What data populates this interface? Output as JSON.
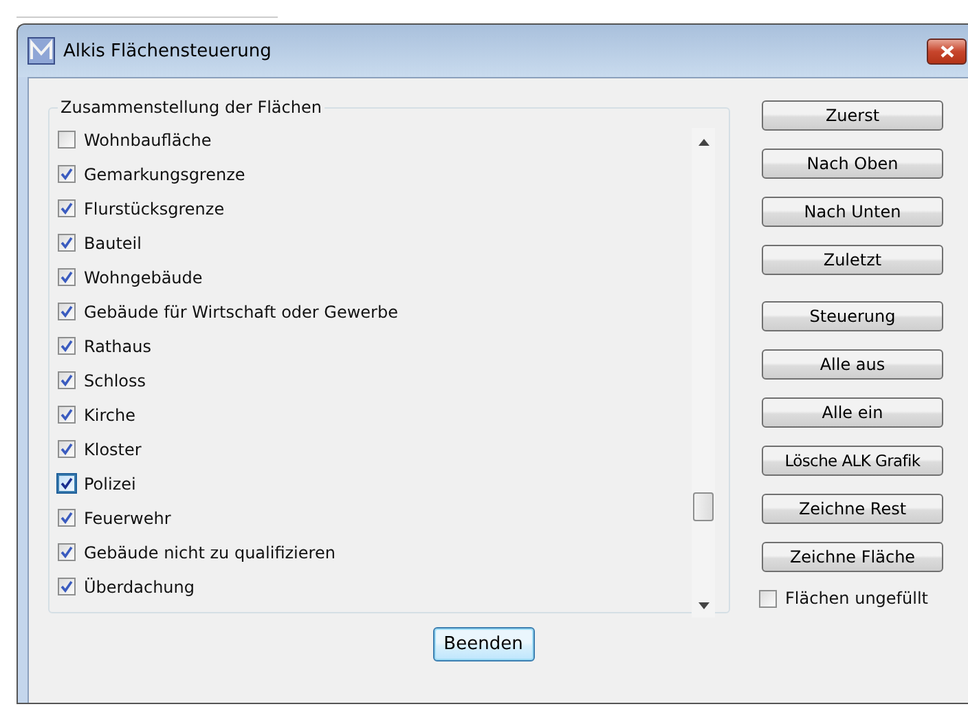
{
  "window": {
    "title": "Alkis Flächensteuerung"
  },
  "group": {
    "title": "Zusammenstellung der Flächen",
    "items": [
      {
        "label": "Wohnbaufläche",
        "checked": false,
        "focused": false
      },
      {
        "label": "Gemarkungsgrenze",
        "checked": true,
        "focused": false
      },
      {
        "label": "Flurstücksgrenze",
        "checked": true,
        "focused": false
      },
      {
        "label": "Bauteil",
        "checked": true,
        "focused": false
      },
      {
        "label": "Wohngebäude",
        "checked": true,
        "focused": false
      },
      {
        "label": "Gebäude für Wirtschaft oder Gewerbe",
        "checked": true,
        "focused": false
      },
      {
        "label": "Rathaus",
        "checked": true,
        "focused": false
      },
      {
        "label": "Schloss",
        "checked": true,
        "focused": false
      },
      {
        "label": "Kirche",
        "checked": true,
        "focused": false
      },
      {
        "label": "Kloster",
        "checked": true,
        "focused": false
      },
      {
        "label": "Polizei",
        "checked": true,
        "focused": true
      },
      {
        "label": "Feuerwehr",
        "checked": true,
        "focused": false
      },
      {
        "label": "Gebäude nicht zu qualifizieren",
        "checked": true,
        "focused": false
      },
      {
        "label": "Überdachung",
        "checked": true,
        "focused": false
      }
    ]
  },
  "buttons": [
    {
      "label": "Zuerst",
      "gap": false
    },
    {
      "label": "Nach Oben",
      "gap": false
    },
    {
      "label": "Nach Unten",
      "gap": false
    },
    {
      "label": "Zuletzt",
      "gap": false
    },
    {
      "label": "Steuerung",
      "gap": true
    },
    {
      "label": "Alle aus",
      "gap": false
    },
    {
      "label": "Alle ein",
      "gap": false
    },
    {
      "label": "Lösche ALK Grafik",
      "gap": false
    },
    {
      "label": "Zeichne Rest",
      "gap": false
    },
    {
      "label": "Zeichne Fläche",
      "gap": false
    }
  ],
  "unfilled": {
    "label": "Flächen ungefüllt",
    "checked": false
  },
  "close_button": {
    "label": "Beenden"
  }
}
